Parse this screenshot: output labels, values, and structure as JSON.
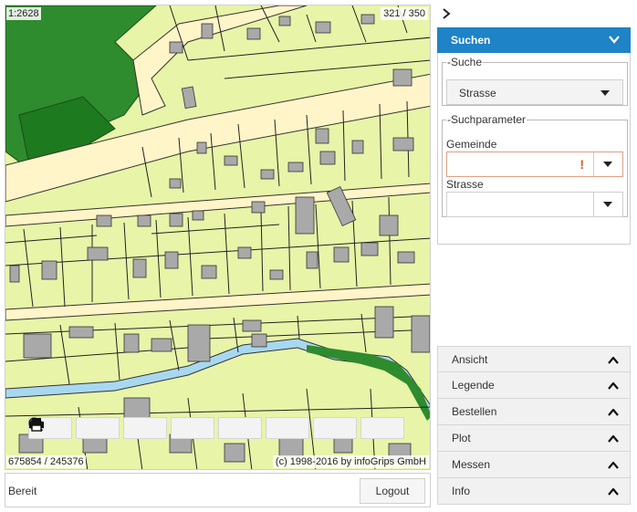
{
  "map": {
    "scale": "1:2628",
    "pager": "321 / 350",
    "coordinates": "675854 / 245376",
    "copyright": "(c) 1998-2016 by infoGrips GmbH",
    "colors": {
      "land": "#e8f4a8",
      "forest": "#2e8b2e",
      "forest_light": "#40a040",
      "building": "#a9a9a9",
      "road": "#fff5c8",
      "water": "#a8d8f0",
      "line": "#222222"
    },
    "toolbar": [
      {
        "name": "home-button",
        "icon": "home-icon"
      },
      {
        "name": "zoom-extent-button",
        "icon": "zoom-extent-icon"
      },
      {
        "name": "zoom-in-button",
        "icon": "zoom-in-icon"
      },
      {
        "name": "zoom-out-button",
        "icon": "zoom-out-icon"
      },
      {
        "name": "locate-button",
        "icon": "locate-arrow-icon"
      },
      {
        "name": "undo-button",
        "icon": "undo-arrow-icon"
      },
      {
        "name": "redo-button",
        "icon": "redo-arrow-icon"
      },
      {
        "name": "print-button",
        "icon": "printer-icon"
      }
    ]
  },
  "status": {
    "text": "Bereit",
    "logout_label": "Logout"
  },
  "panel": {
    "collapse_icon": "chevron-right-icon",
    "suchen": {
      "title": "Suchen",
      "suche_legend": "Suche",
      "suche_value": "Strasse",
      "params_legend": "Suchparameter",
      "gemeinde_label": "Gemeinde",
      "gemeinde_value": "",
      "gemeinde_error": "!",
      "strasse_label": "Strasse",
      "strasse_value": ""
    },
    "accordion": [
      {
        "label": "Ansicht"
      },
      {
        "label": "Legende"
      },
      {
        "label": "Bestellen"
      },
      {
        "label": "Plot"
      },
      {
        "label": "Messen"
      },
      {
        "label": "Info"
      }
    ],
    "accent_color": "#1e83c7"
  }
}
